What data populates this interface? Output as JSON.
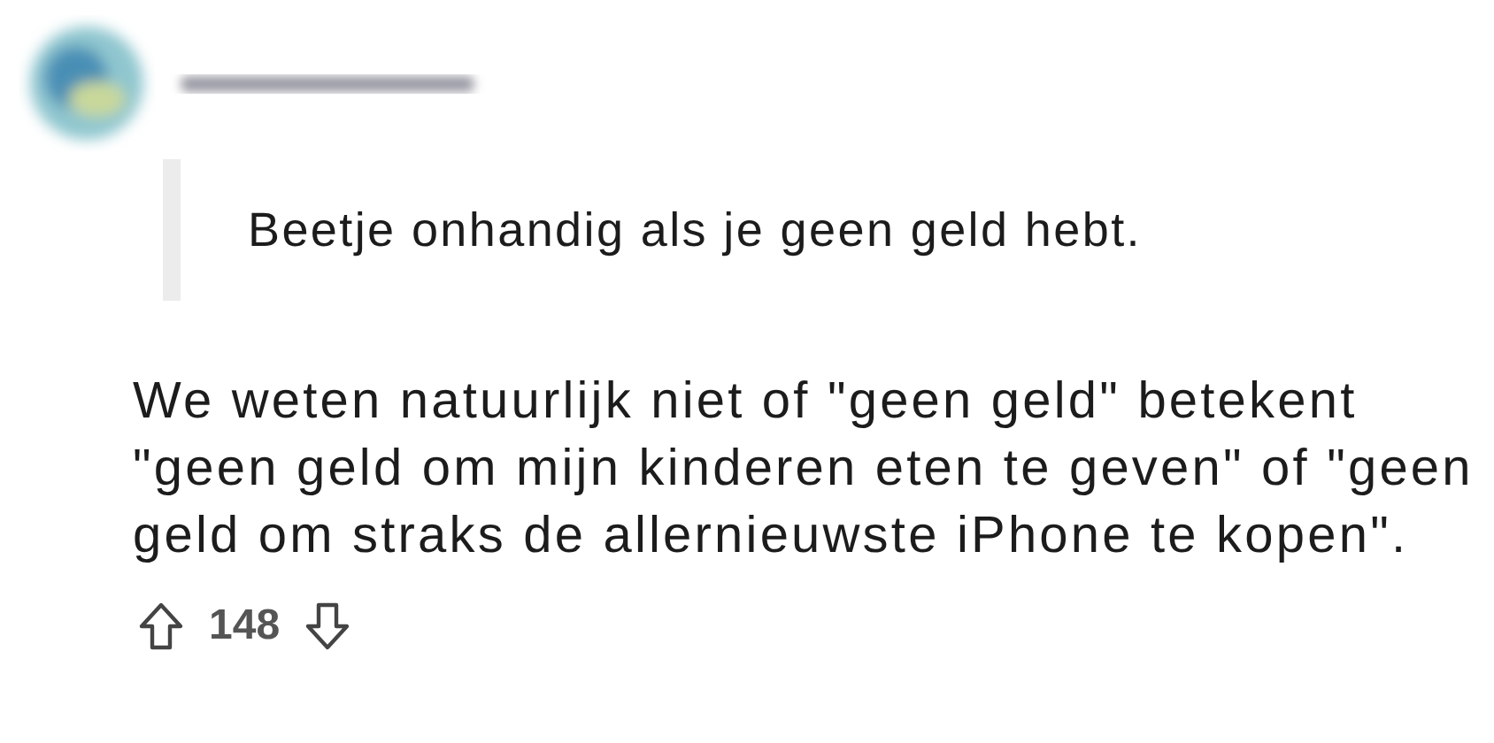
{
  "comment": {
    "quote": "Beetje onhandig als je geen geld hebt.",
    "body": "We weten natuurlijk niet of \"geen geld\" betekent \"geen geld om mijn kinderen eten te geven\" of \"geen geld om straks de allernieuwste iPhone te kopen\".",
    "score": "148"
  }
}
